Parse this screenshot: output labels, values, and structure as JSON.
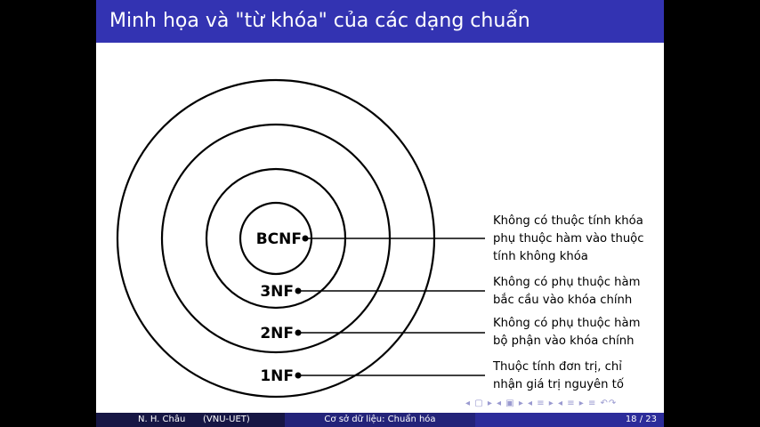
{
  "slide": {
    "title": "Minh họa và \"từ khóa\" của các dạng chuẩn"
  },
  "diagram": {
    "levels": [
      {
        "label": "BCNF",
        "description_lines": [
          "Không có thuộc tính khóa",
          "phụ thuộc hàm vào thuộc",
          "tính không khóa"
        ]
      },
      {
        "label": "3NF",
        "description_lines": [
          "Không có phụ thuộc hàm",
          "bắc cầu vào khóa chính"
        ]
      },
      {
        "label": "2NF",
        "description_lines": [
          "Không có phụ thuộc hàm",
          "bộ phận vào khóa chính"
        ]
      },
      {
        "label": "1NF",
        "description_lines": [
          "Thuộc tính đơn trị, chỉ",
          "nhận giá trị nguyên tố"
        ]
      }
    ]
  },
  "footer": {
    "author": "N. H. Châu",
    "institution": "(VNU-UET)",
    "course": "Cơ sở dữ liệu: Chuẩn hóa",
    "page": "18 / 23"
  },
  "navigation": {
    "symbols": "◂ ▢ ▸ ◂ ▣ ▸ ◂ ≡ ▸ ◂ ≡ ▸ ≡ ↶↷"
  },
  "colors": {
    "title_bar": "#3333b2",
    "footer_left": "#161644",
    "footer_mid": "#232379",
    "footer_right": "#2c2c9a"
  }
}
